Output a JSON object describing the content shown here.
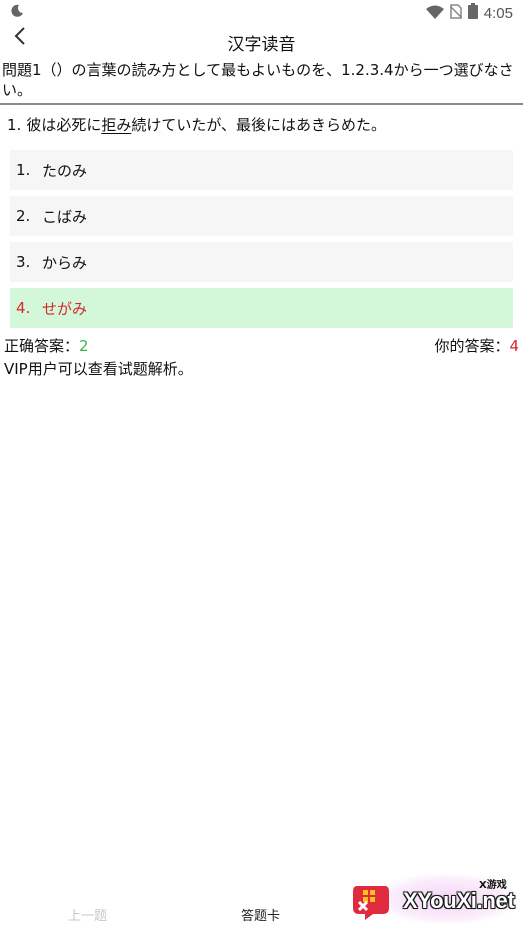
{
  "status_bar": {
    "time": "4:05",
    "icons": [
      "moon-icon",
      "wifi-icon",
      "no-sim-icon",
      "battery-icon"
    ]
  },
  "header": {
    "title": "汉字读音",
    "back_icon": "chevron-left-icon"
  },
  "instruction": "問題1（）の言葉の読み方として最もよいものを、1.2.3.4から一つ選びなさい。",
  "question": {
    "number": "1.",
    "text_before": "彼は必死に",
    "underlined": "拒み",
    "text_after": "続けていたが、最後にはあきらめた。"
  },
  "options": [
    {
      "number": "1.",
      "text": "たのみ",
      "selected": false
    },
    {
      "number": "2.",
      "text": "こばみ",
      "selected": false
    },
    {
      "number": "3.",
      "text": "からみ",
      "selected": false
    },
    {
      "number": "4.",
      "text": "せがみ",
      "selected": true
    }
  ],
  "answer": {
    "correct_label": "正确答案：",
    "correct_value": "2",
    "yours_label": "你的答案：",
    "yours_value": "4"
  },
  "vip_note": "VIP用户可以查看试题解析。",
  "bottom_nav": {
    "prev_label": "上一题",
    "card_label": "答题卡"
  },
  "watermark": {
    "brand": "XYouXi.net",
    "sub": "X游戏"
  },
  "colors": {
    "correct": "#3cb54a",
    "wrong": "#d8262a",
    "selected_bg": "#d2f8d9",
    "option_bg": "#f6f6f6"
  }
}
